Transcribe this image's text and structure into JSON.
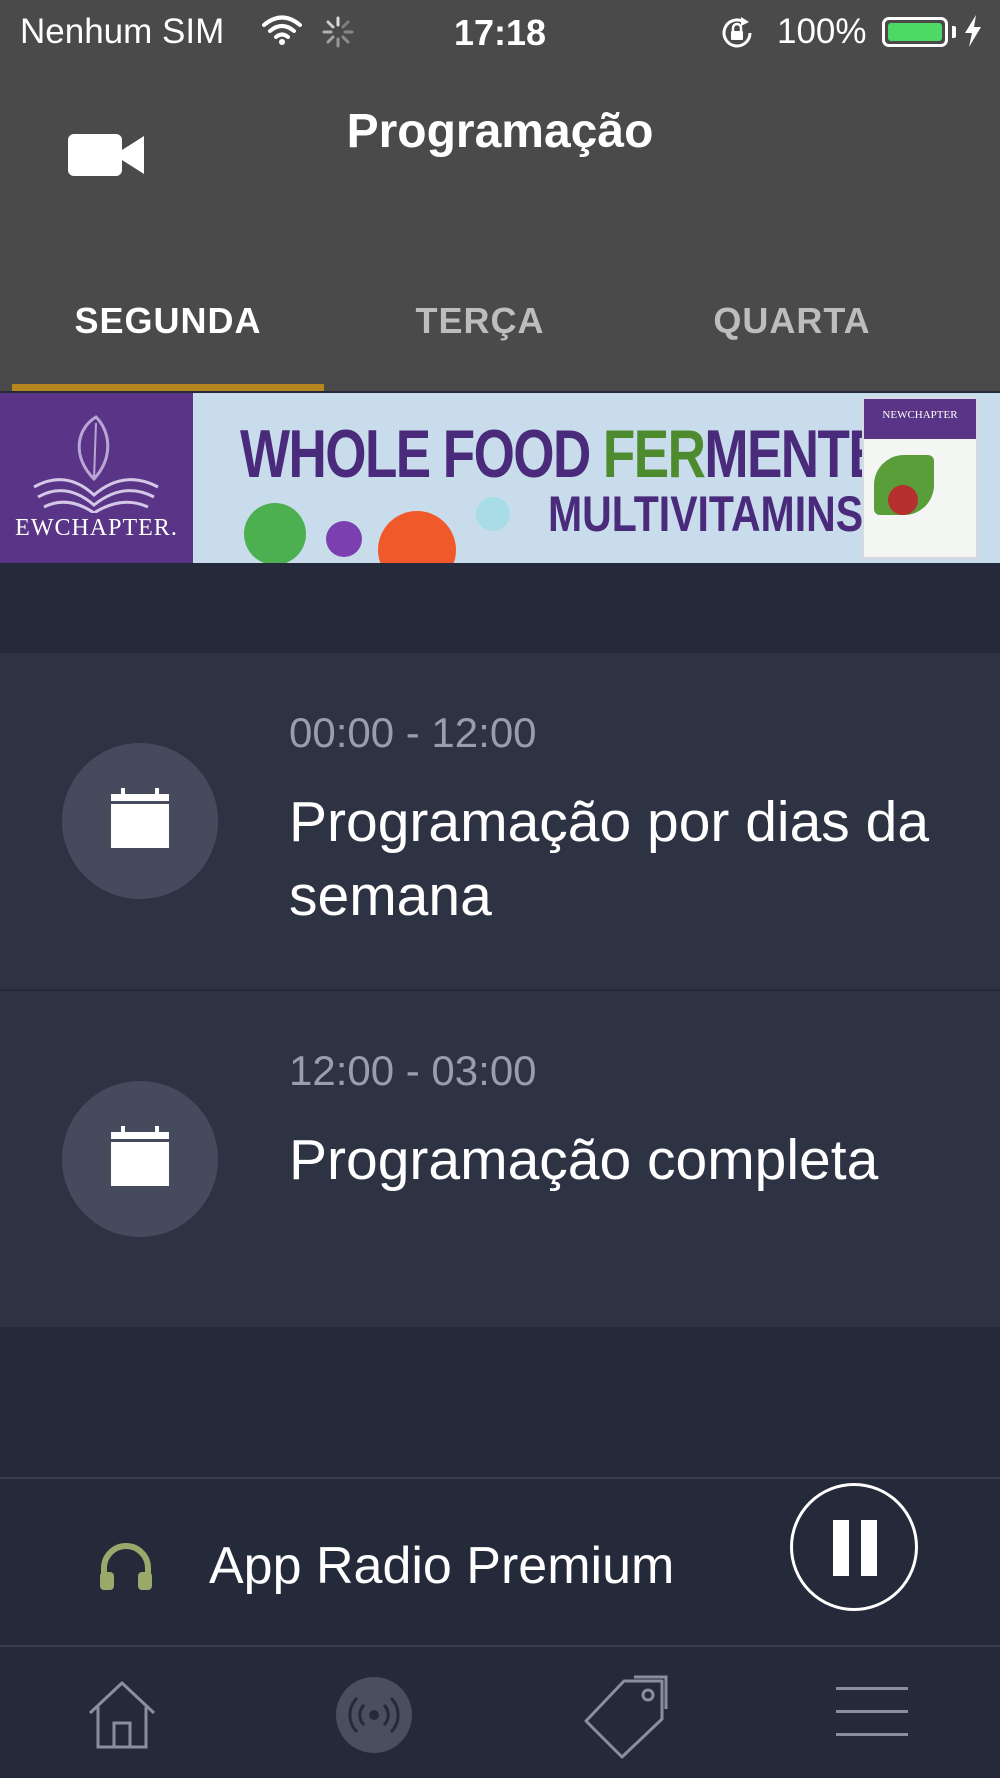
{
  "status_bar": {
    "carrier": "Nenhum SIM",
    "time": "17:18",
    "battery_percent": "100%",
    "battery_level": 1.0,
    "icons": [
      "wifi-icon",
      "activity-spinner-icon",
      "rotation-lock-icon",
      "battery-icon",
      "charging-bolt-icon"
    ],
    "battery_color": "#4cd964"
  },
  "header": {
    "title": "Programação",
    "left_icon": "video-camera-icon"
  },
  "tabs": [
    {
      "label": "SEGUNDA",
      "active": true
    },
    {
      "label": "TERÇA",
      "active": false
    },
    {
      "label": "QUARTA",
      "active": false
    }
  ],
  "tab_indicator_color": "#b7871f",
  "banner": {
    "brand": "EWCHAPTER.",
    "line1_a": "WHOLE FOOD ",
    "line1_b": "FER",
    "line1_c": "MENTED",
    "line2": "MULTIVITAMINS",
    "box_brand": "NEWCHAPTER"
  },
  "schedule": [
    {
      "time": "00:00 - 12:00",
      "title": "Programação por dias da semana",
      "icon": "calendar-icon"
    },
    {
      "time": "12:00 - 03:00",
      "title": "Programação completa",
      "icon": "calendar-icon"
    }
  ],
  "player": {
    "station": "App Radio Premium",
    "icon": "headphones-icon",
    "state": "playing",
    "control_icon": "pause-icon"
  },
  "bottom_nav": [
    {
      "icon": "home-icon",
      "name": "nav-home"
    },
    {
      "icon": "radio-broadcast-icon",
      "name": "nav-radio"
    },
    {
      "icon": "tags-icon",
      "name": "nav-tags"
    },
    {
      "icon": "menu-icon",
      "name": "nav-menu"
    }
  ],
  "colors": {
    "header_bg": "#4a4a4a",
    "page_bg": "#252a3a",
    "row_bg": "#2e3344",
    "headphones": "#9aa86a"
  }
}
